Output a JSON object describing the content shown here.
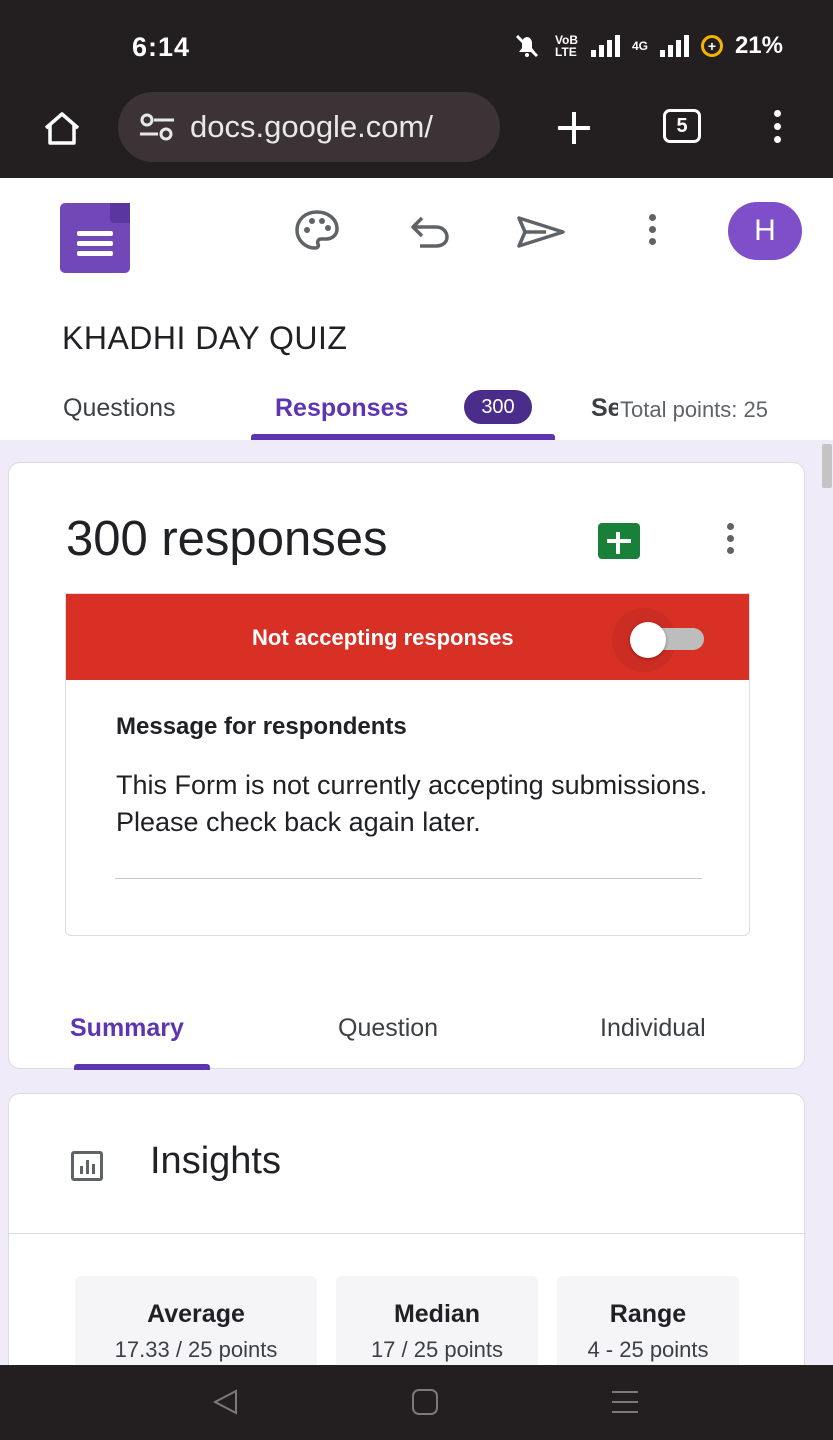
{
  "status_bar": {
    "time": "6:14",
    "network_label": "VoB LTE",
    "network_type": "4G",
    "battery": "21%"
  },
  "browser": {
    "url": "docs.google.com/",
    "tab_count": "5"
  },
  "header": {
    "avatar_initial": "H"
  },
  "form": {
    "title": "KHADHI DAY QUIZ",
    "total_points": "Total points: 25",
    "tabs": [
      {
        "label": "Questions"
      },
      {
        "label": "Responses",
        "badge": "300"
      },
      {
        "label": "Se"
      }
    ]
  },
  "responses": {
    "count_label": "300 responses",
    "status_text": "Not accepting responses",
    "accepting": false,
    "message_title": "Message for respondents",
    "message_body": "This Form is not currently accepting submissions. Please check back again later.",
    "sub_tabs": [
      {
        "label": "Summary"
      },
      {
        "label": "Question"
      },
      {
        "label": "Individual"
      }
    ]
  },
  "insights": {
    "title": "Insights",
    "stats": [
      {
        "label": "Average",
        "value": "17.33 / 25 points"
      },
      {
        "label": "Median",
        "value": "17 / 25 points"
      },
      {
        "label": "Range",
        "value": "4 - 25 points"
      }
    ]
  },
  "colors": {
    "accent": "#5e35b1",
    "alert": "#d93025",
    "background": "#f0ebf8",
    "sheets": "#188038"
  },
  "icons": [
    "home-icon",
    "site-settings-icon",
    "new-tab-icon",
    "menu-icon",
    "palette-icon",
    "undo-icon",
    "send-icon",
    "more-icon",
    "sheets-icon",
    "insights-icon",
    "back-icon",
    "home-nav-icon",
    "recents-icon"
  ]
}
